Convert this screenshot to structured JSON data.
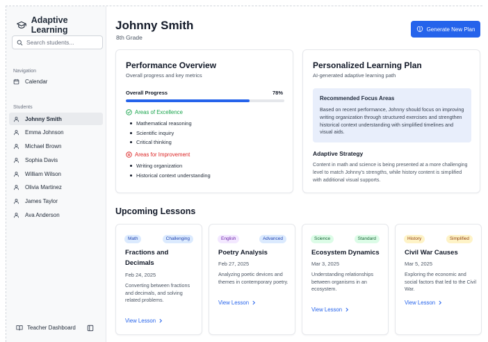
{
  "app": {
    "title": "Adaptive Learning"
  },
  "search": {
    "placeholder": "Search students..."
  },
  "navigation": {
    "label": "Navigation",
    "items": [
      {
        "label": "Calendar",
        "icon": "calendar-icon"
      }
    ]
  },
  "students": {
    "label": "Students",
    "items": [
      "Johnny Smith",
      "Emma Johnson",
      "Michael Brown",
      "Sophia Davis",
      "William Wilson",
      "Olivia Martinez",
      "James Taylor",
      "Ava Anderson"
    ],
    "active": "Johnny Smith"
  },
  "footer": {
    "label": "Teacher Dashboard"
  },
  "header": {
    "name": "Johnny Smith",
    "grade": "8th Grade",
    "button": "Generate New Plan"
  },
  "performance": {
    "title": "Performance Overview",
    "subtitle": "Overall progress and key metrics",
    "progress_label": "Overall Progress",
    "progress_value": "78%",
    "progress_fraction": 0.78,
    "excellence_label": "Areas of Excellence",
    "excellence": [
      "Mathematical reasoning",
      "Scientific inquiry",
      "Critical thinking"
    ],
    "improvement_label": "Areas for Improvement",
    "improvement": [
      "Writing organization",
      "Historical context understanding"
    ]
  },
  "plan": {
    "title": "Personalized Learning Plan",
    "subtitle": "AI-generated adaptive learning path",
    "focus_title": "Recommended Focus Areas",
    "focus_text": "Based on recent performance, Johnny should focus on improving writing organization through structured exercises and strengthen historical context understanding with simplified timelines and visual aids.",
    "strategy_title": "Adaptive Strategy",
    "strategy_text": "Content in math and science is being presented at a more challenging level to match Johnny's strengths, while history content is simplified with additional visual supports."
  },
  "lessons": {
    "title": "Upcoming Lessons",
    "link_label": "View Lesson",
    "items": [
      {
        "subject": "Math",
        "level": "Challenging",
        "title": "Fractions and Decimals",
        "date": "Feb 24, 2025",
        "description": "Converting between fractions and decimals, and solving related problems.",
        "subject_bg": "#dbeafe",
        "subject_fg": "#1e40af",
        "level_bg": "#dbeafe",
        "level_fg": "#1e40af"
      },
      {
        "subject": "English",
        "level": "Advanced",
        "title": "Poetry Analysis",
        "date": "Feb 27, 2025",
        "description": "Analyzing poetic devices and themes in contemporary poetry.",
        "subject_bg": "#f3e8ff",
        "subject_fg": "#6b21a8",
        "level_bg": "#dbeafe",
        "level_fg": "#1e40af"
      },
      {
        "subject": "Science",
        "level": "Standard",
        "title": "Ecosystem Dynamics",
        "date": "Mar 3, 2025",
        "description": "Understanding relationships between organisms in an ecosystem.",
        "subject_bg": "#dcfce7",
        "subject_fg": "#166534",
        "level_bg": "#dcfce7",
        "level_fg": "#166534"
      },
      {
        "subject": "History",
        "level": "Simplified",
        "title": "Civil War Causes",
        "date": "Mar 5, 2025",
        "description": "Exploring the economic and social factors that led to the Civil War.",
        "subject_bg": "#fef3c7",
        "subject_fg": "#92400e",
        "level_bg": "#fef3c7",
        "level_fg": "#92400e"
      }
    ]
  },
  "colors": {
    "accent": "#2563eb",
    "success": "#16a34a",
    "danger": "#dc2626",
    "focus_bg": "#e8eefb"
  }
}
